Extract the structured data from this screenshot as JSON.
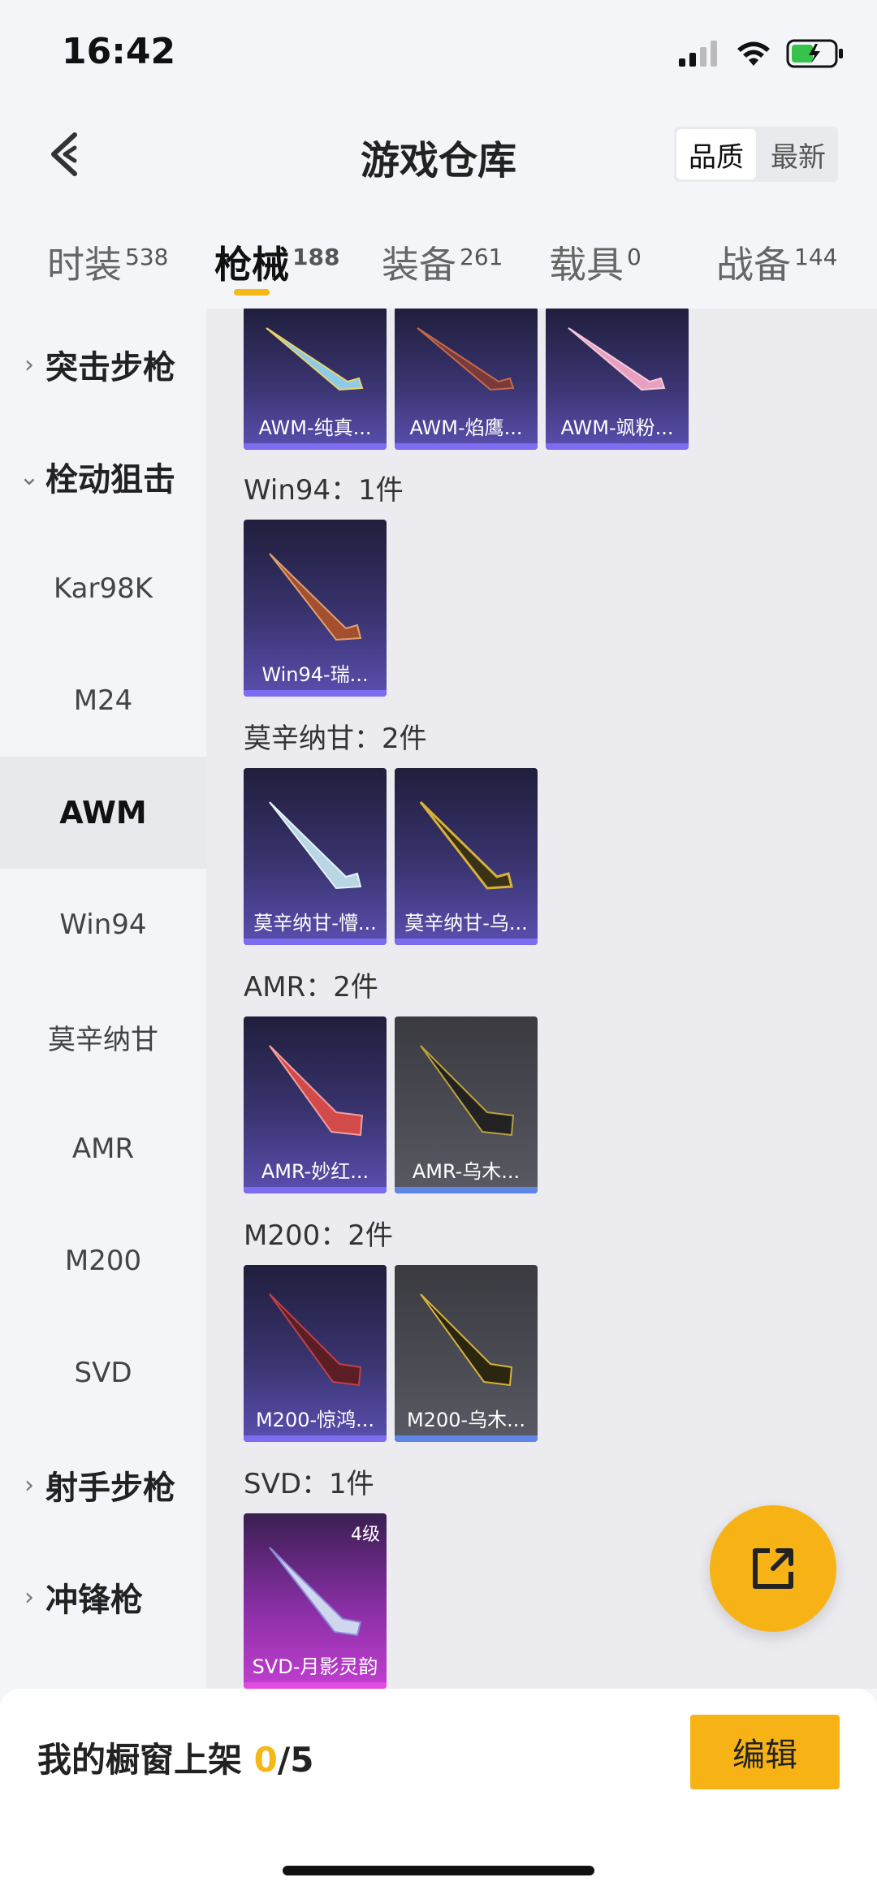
{
  "status_bar": {
    "time": "16:42"
  },
  "header": {
    "title": "游戏仓库",
    "sort_options": [
      "品质",
      "最新"
    ],
    "active_sort": "品质"
  },
  "tabs": [
    {
      "label": "时装",
      "count": "538"
    },
    {
      "label": "枪械",
      "count": "188"
    },
    {
      "label": "装备",
      "count": "261"
    },
    {
      "label": "载具",
      "count": "0"
    },
    {
      "label": "战备",
      "count": "144"
    }
  ],
  "sidebar": {
    "items": [
      {
        "label": "突击步枪",
        "type": "group"
      },
      {
        "label": "栓动狙击",
        "type": "group-open"
      },
      {
        "label": "Kar98K"
      },
      {
        "label": "M24"
      },
      {
        "label": "AWM",
        "active": true
      },
      {
        "label": "Win94"
      },
      {
        "label": "莫辛纳甘"
      },
      {
        "label": "AMR"
      },
      {
        "label": "M200"
      },
      {
        "label": "SVD"
      },
      {
        "label": "射手步枪",
        "type": "group"
      },
      {
        "label": "冲锋枪",
        "type": "group"
      }
    ]
  },
  "content": {
    "sections": [
      {
        "label": "",
        "items": [
          "AWM-纯真...",
          "AWM-焰鹰...",
          "AWM-飒粉..."
        ]
      },
      {
        "label": "Win94：1件",
        "items": [
          "Win94-瑞..."
        ]
      },
      {
        "label": "莫辛纳甘：2件",
        "items": [
          "莫辛纳甘-懵...",
          "莫辛纳甘-乌..."
        ]
      },
      {
        "label": "AMR：2件",
        "items": [
          "AMR-妙红...",
          "AMR-乌木..."
        ]
      },
      {
        "label": "M200：2件",
        "items": [
          "M200-惊鸿...",
          "M200-乌木..."
        ]
      },
      {
        "label": "SVD：1件",
        "items": [
          "SVD-月影灵韵"
        ],
        "level": "4级"
      }
    ]
  },
  "bottom": {
    "shelf_label": "我的橱窗上架",
    "shelf_count": "0",
    "shelf_total": "/5",
    "edit_label": "编辑"
  }
}
